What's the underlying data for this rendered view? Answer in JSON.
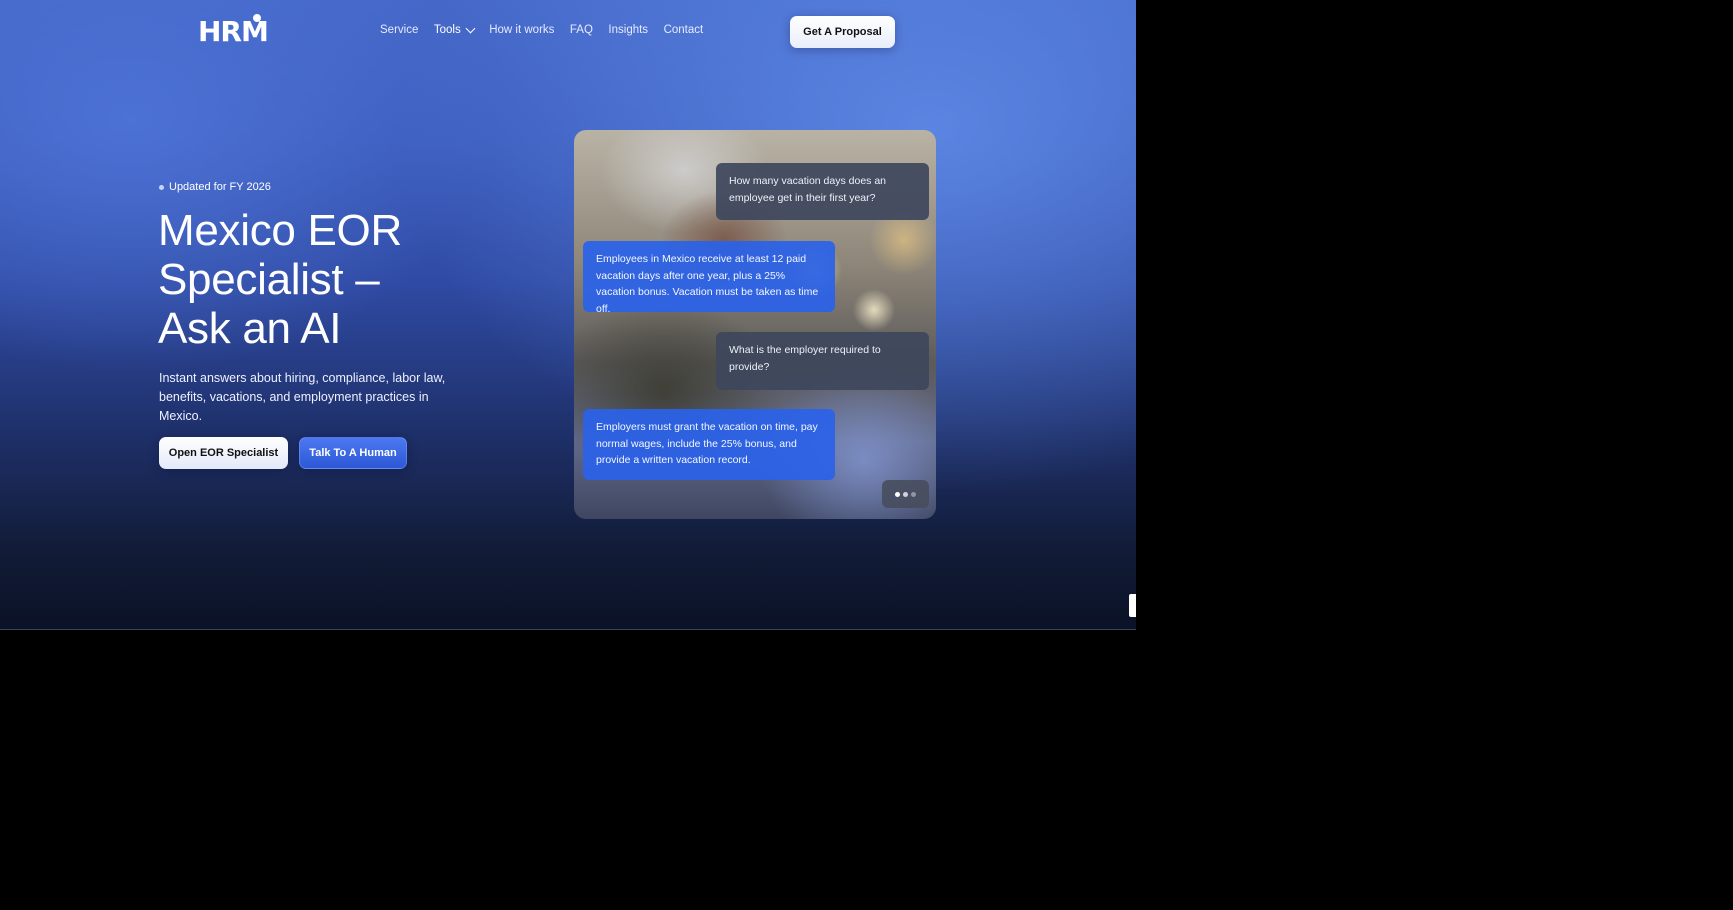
{
  "brand": {
    "logo_text": "HRM"
  },
  "nav": {
    "items": [
      {
        "label": "Service"
      },
      {
        "label": "Tools"
      },
      {
        "label": "How it works"
      },
      {
        "label": "FAQ"
      },
      {
        "label": "Insights"
      },
      {
        "label": "Contact"
      }
    ],
    "cta_label": "Get A Proposal"
  },
  "hero": {
    "badge": "Updated for FY 2026",
    "title": "Mexico EOR\nSpecialist –\nAsk an AI",
    "subtitle": "Instant answers about hiring, compliance, labor law, benefits, vacations, and employment practices in Mexico.",
    "primary_button": "Open EOR Specialist",
    "secondary_button": "Talk To A Human"
  },
  "chat": {
    "messages": [
      {
        "role": "question",
        "text": "How many vacation days does an employee get in their first year?"
      },
      {
        "role": "answer",
        "text": "Employees in Mexico receive at least 12 paid vacation days after one year, plus a 25% vacation bonus. Vacation must be taken as time off."
      },
      {
        "role": "question",
        "text": "What is the employer required to provide?"
      },
      {
        "role": "answer",
        "text": "Employers must grant the vacation on time, pay normal wages, include the 25% bonus, and provide a written vacation record."
      }
    ],
    "pagination": {
      "total": 3,
      "active": 1
    }
  },
  "colors": {
    "accent": "#2f5de0",
    "answer_bubble": "#2b62e8",
    "question_bubble": "#3e465c"
  }
}
